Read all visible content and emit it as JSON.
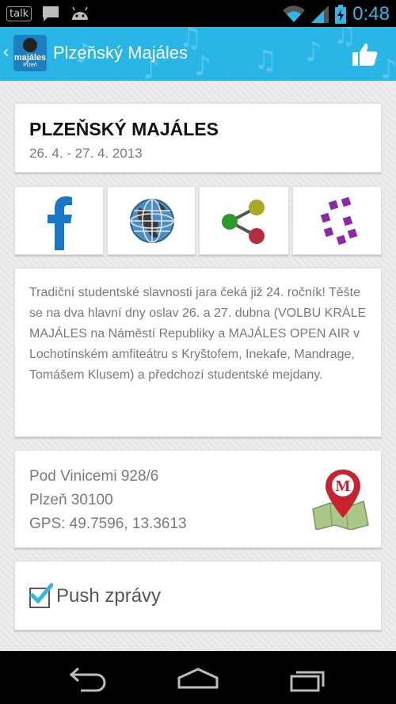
{
  "status_bar": {
    "notification_talk": "talk",
    "time": "0:48",
    "icons": [
      "talk-icon",
      "message-icon",
      "android-icon",
      "wifi-icon",
      "signal-icon",
      "battery-icon"
    ]
  },
  "action_bar": {
    "title": "Plzeňský Majáles",
    "logo_text": "majáles",
    "logo_subtext": "Plzeň",
    "color": "#29b6e6"
  },
  "event": {
    "title": "PLZEŇSKÝ MAJÁLES",
    "date": "26. 4. - 27. 4. 2013"
  },
  "actions": [
    {
      "name": "facebook",
      "icon": "facebook-icon"
    },
    {
      "name": "web",
      "icon": "globe-icon"
    },
    {
      "name": "share",
      "icon": "share-icon"
    },
    {
      "name": "other",
      "icon": "g-logo-icon"
    }
  ],
  "description": "Tradiční studentské slavnosti jara čeká již 24. ročník! Těšte se na dva hlavní dny oslav 26. a 27. dubna (VOLBU KRÁLE MAJÁLES na Náměstí Republiky a MAJÁLES OPEN AIR v Lochotínském amfiteátru s Kryštofem, Inekafe, Mandrage, Tomášem Klusem) a předchozí studentské mejdany.",
  "address": {
    "street": "Pod Vinicemi 928/6",
    "city": "Plzeň 30100",
    "gps": "GPS: 49.7596, 13.3613",
    "map_pin_letter": "M"
  },
  "push": {
    "label": "Push zprávy",
    "checked": true
  }
}
